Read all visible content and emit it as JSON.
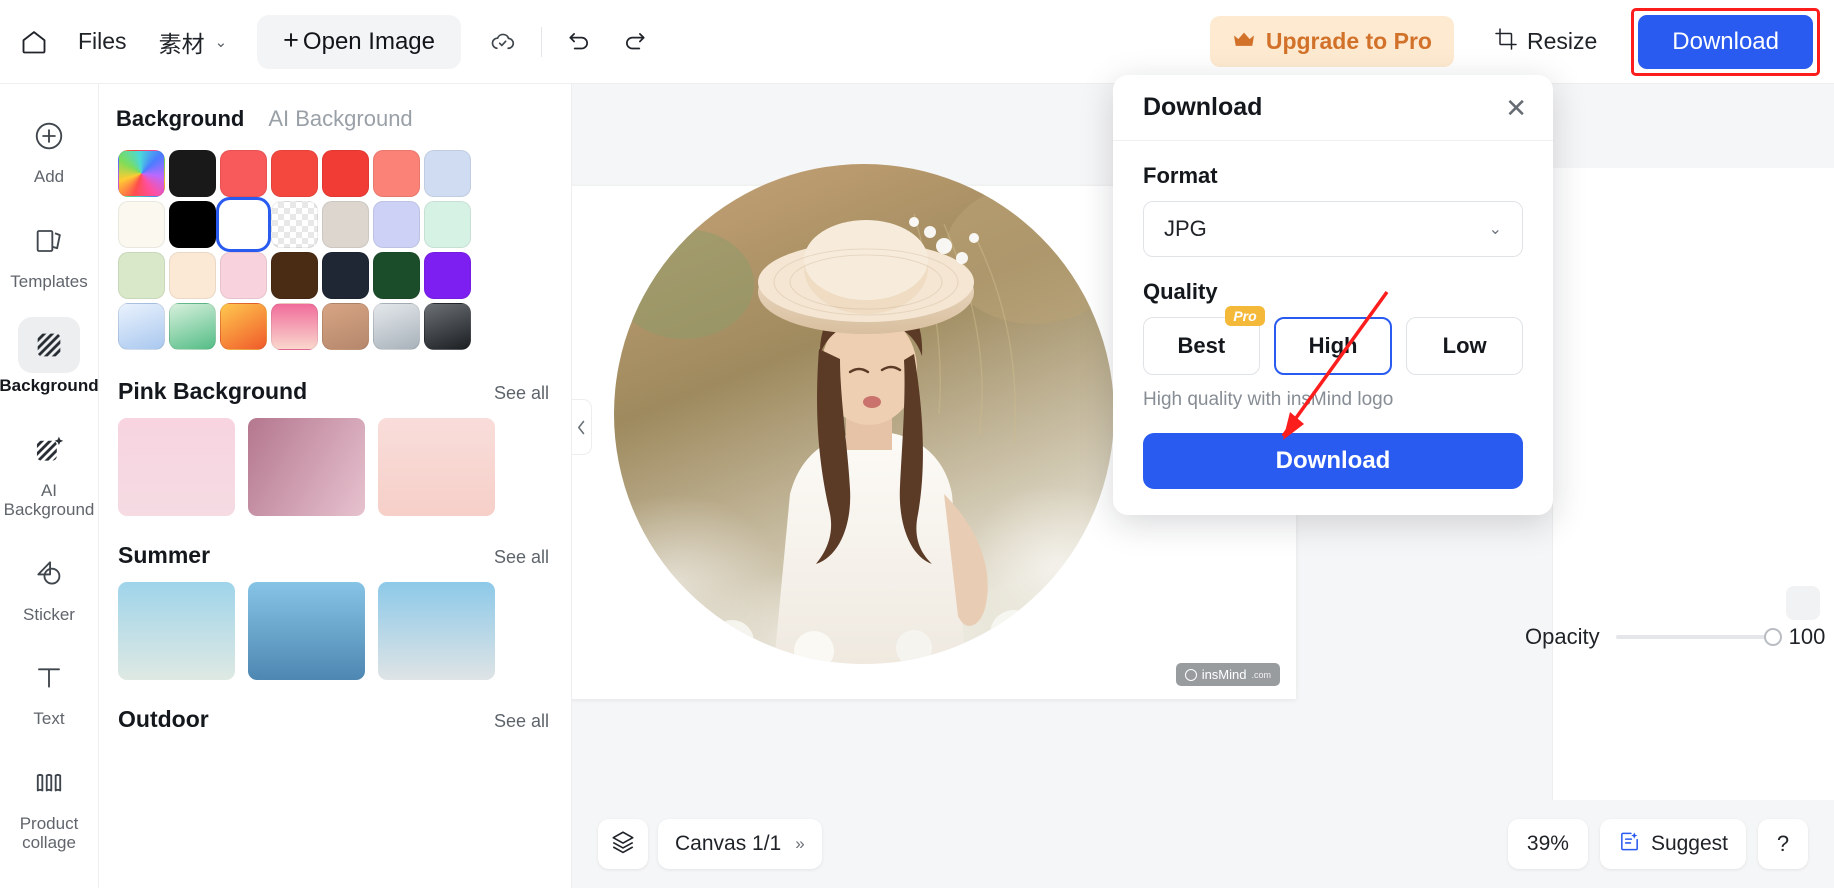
{
  "topbar": {
    "home_icon": "home-icon",
    "files_label": "Files",
    "assets_label": "素材",
    "assets_caret": "⌄",
    "open_image_label": "Open Image",
    "open_image_plus": "+",
    "cloud_icon": "cloud-sync-icon",
    "undo_icon": "undo-icon",
    "redo_icon": "redo-icon",
    "upgrade_label": "Upgrade to Pro",
    "upgrade_icon": "crown-icon",
    "upgrade_bg": "#fdead1",
    "upgrade_fg": "#d2722a",
    "resize_label": "Resize",
    "resize_icon": "crop-icon",
    "download_label": "Download",
    "download_bg": "#2a5bf0",
    "highlight_color": "#fc1d1d"
  },
  "rail": {
    "items": [
      {
        "icon": "plus-circle-icon",
        "label": "Add",
        "active": false
      },
      {
        "icon": "templates-icon",
        "label": "Templates",
        "active": false
      },
      {
        "icon": "background-hatch-icon",
        "label": "Background",
        "active": true
      },
      {
        "icon": "ai-background-icon",
        "label": "AI\nBackground",
        "active": false
      },
      {
        "icon": "sticker-icon",
        "label": "Sticker",
        "active": false
      },
      {
        "icon": "text-icon",
        "label": "Text",
        "active": false
      },
      {
        "icon": "product-collage-icon",
        "label": "Product\ncollage",
        "active": false
      }
    ]
  },
  "panel": {
    "tabs": [
      {
        "label": "Background",
        "active": true
      },
      {
        "label": "AI Background",
        "active": false
      }
    ],
    "collapse_icon": "chevron-left-icon",
    "swatches": [
      {
        "name": "rainbow-picker",
        "kind": "rainbow",
        "selected": false
      },
      {
        "name": "near-black",
        "color": "#191919",
        "selected": false
      },
      {
        "name": "coral-red",
        "color": "#f8595a",
        "selected": false
      },
      {
        "name": "red-dotted",
        "color": "#f4483f",
        "selected": false
      },
      {
        "name": "bright-red",
        "color": "#f03c35",
        "selected": false
      },
      {
        "name": "salmon",
        "color": "#fa8277",
        "selected": false
      },
      {
        "name": "pale-blue",
        "color": "#cfdcf2",
        "selected": false
      },
      {
        "name": "ivory",
        "color": "#fbf9ef",
        "selected": false
      },
      {
        "name": "black",
        "color": "#000000",
        "selected": false
      },
      {
        "name": "white",
        "color": "#ffffff",
        "selected": true
      },
      {
        "name": "transparent",
        "kind": "checker",
        "selected": false
      },
      {
        "name": "warm-grey",
        "color": "#dcd6cf",
        "selected": false
      },
      {
        "name": "periwinkle-dotted",
        "color": "#ccd1f5",
        "selected": false
      },
      {
        "name": "mint",
        "color": "#d6f2e5",
        "selected": false
      },
      {
        "name": "pale-green",
        "color": "#d8e8c8",
        "selected": false
      },
      {
        "name": "cream",
        "color": "#fbe9d6",
        "selected": false
      },
      {
        "name": "pale-pink",
        "color": "#f8d2dc",
        "selected": false
      },
      {
        "name": "dark-brown",
        "color": "#4a2b14",
        "selected": false
      },
      {
        "name": "navy-charcoal",
        "color": "#1f2634",
        "selected": false
      },
      {
        "name": "forest-green",
        "color": "#1b4d2a",
        "selected": false
      },
      {
        "name": "violet",
        "color": "#7d1ff0",
        "selected": false
      },
      {
        "name": "blue-gradient",
        "gradient": "linear-gradient(160deg,#eaf2fd,#a9c8ef)",
        "selected": false
      },
      {
        "name": "green-gradient",
        "gradient": "linear-gradient(160deg,#d7f0dc,#54bd86)",
        "selected": false
      },
      {
        "name": "orange-gradient",
        "gradient": "linear-gradient(150deg,#ffc84f,#f05a2a)",
        "selected": false
      },
      {
        "name": "pink-gradient",
        "gradient": "linear-gradient(180deg,#f06d9b,#fad7cd)",
        "selected": false
      },
      {
        "name": "tan-gradient",
        "gradient": "linear-gradient(160deg,#d7a584,#b5876c)",
        "selected": false
      },
      {
        "name": "silver-gradient",
        "gradient": "linear-gradient(160deg,#e4e8ec,#a8b2ba)",
        "selected": false
      },
      {
        "name": "dark-gradient",
        "gradient": "linear-gradient(160deg,#6b7075,#1c1f22)",
        "selected": false
      }
    ],
    "sections": [
      {
        "title": "Pink Background",
        "see_all": "See all",
        "thumbs": [
          {
            "name": "pink-blossom-thumb",
            "bg": "linear-gradient(180deg,#f7d4e0,#f6dbe3)"
          },
          {
            "name": "pink-curtain-thumb",
            "bg": "linear-gradient(120deg,#b4778e,#e7c2cf)"
          },
          {
            "name": "pink-tulip-thumb",
            "bg": "linear-gradient(180deg,#f9ddda,#f6cfc8)"
          }
        ]
      },
      {
        "title": "Summer",
        "see_all": "See all",
        "thumbs": [
          {
            "name": "palm-beach-thumb",
            "bg": "linear-gradient(180deg,#9fd4ea,#dfe9e3)"
          },
          {
            "name": "ocean-thumb",
            "bg": "linear-gradient(180deg,#86c4e6,#4e87b2)"
          },
          {
            "name": "blue-sky-wall-thumb",
            "bg": "linear-gradient(180deg,#8dc9e8,#dfe4e6)"
          }
        ]
      },
      {
        "title": "Outdoor",
        "see_all": "See all",
        "thumbs": []
      }
    ]
  },
  "canvas": {
    "watermark_label": "insMind",
    "watermark_suffix": ".com",
    "layers_icon": "layers-icon",
    "canvas_label": "Canvas 1/1",
    "canvas_chevron": "»",
    "zoom_label": "39%",
    "suggest_label": "Suggest",
    "suggest_icon": "suggest-icon",
    "help_label": "?"
  },
  "properties": {
    "opacity_label": "Opacity",
    "opacity_value": "100"
  },
  "dialog": {
    "title": "Download",
    "close_icon": "close-icon",
    "format_label": "Format",
    "format_value": "JPG",
    "format_chevron": "⌄",
    "quality_label": "Quality",
    "quality_options": [
      {
        "label": "Best",
        "badge": "Pro",
        "active": false
      },
      {
        "label": "High",
        "badge": "",
        "active": true
      },
      {
        "label": "Low",
        "badge": "",
        "active": false
      }
    ],
    "quality_note": "High quality with insMind logo",
    "download_label": "Download",
    "accent": "#2a5bf0",
    "pro_badge_bg": "#f5b93a"
  }
}
